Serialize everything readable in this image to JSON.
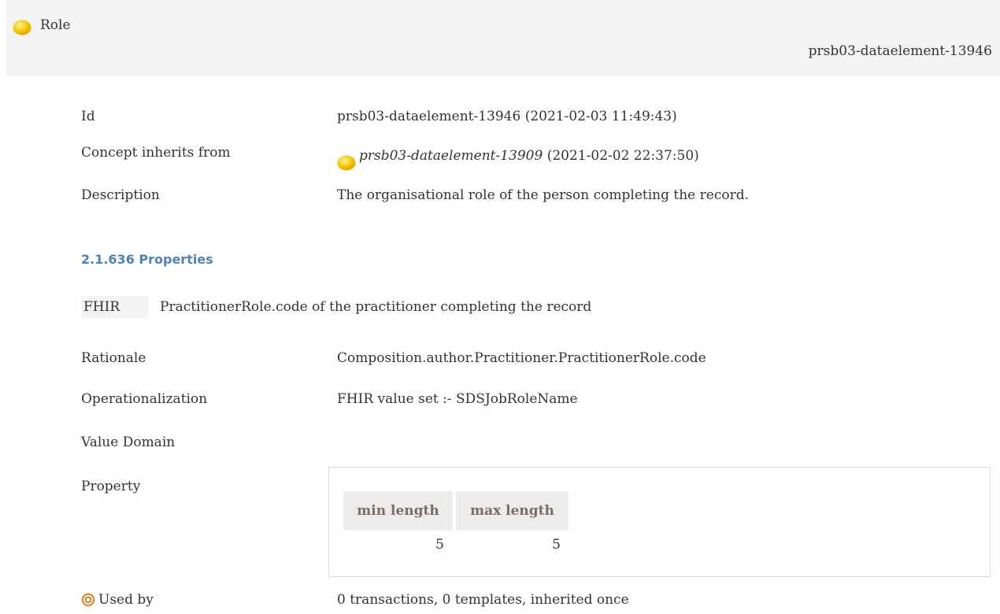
{
  "header": {
    "title": "Role",
    "id_right": "prsb03-dataelement-13946",
    "dot_color": "#f5c400"
  },
  "details": {
    "id_label": "Id",
    "id_value": "prsb03-dataelement-13946 (2021-02-03 11:49:43)",
    "inherits_label": "Concept inherits from",
    "inherits_link": "prsb03-dataelement-13909",
    "inherits_date": " (2021-02-02 22:37:50)",
    "description_label": "Description",
    "description_value": "The organisational role of the person completing the record."
  },
  "properties_section": {
    "title": "2.1.636 Properties"
  },
  "fhir": {
    "tag": "FHIR",
    "text": "PractitionerRole.code of the practitioner completing the record"
  },
  "fields": {
    "rationale_label": "Rationale",
    "rationale_value": "Composition.author.Practitioner.PractitionerRole.code",
    "operationalization_label": "Operationalization",
    "operationalization_value": "FHIR value set :- SDSJobRoleName",
    "value_domain_label": "Value Domain",
    "property_label": "Property"
  },
  "property_table": {
    "headers": [
      "min length",
      "max length"
    ],
    "values": [
      "5",
      "5"
    ]
  },
  "used_by": {
    "label": "Used by",
    "value": "0 transactions, 0 templates, inherited once",
    "icon_color": "#e07a1f"
  }
}
